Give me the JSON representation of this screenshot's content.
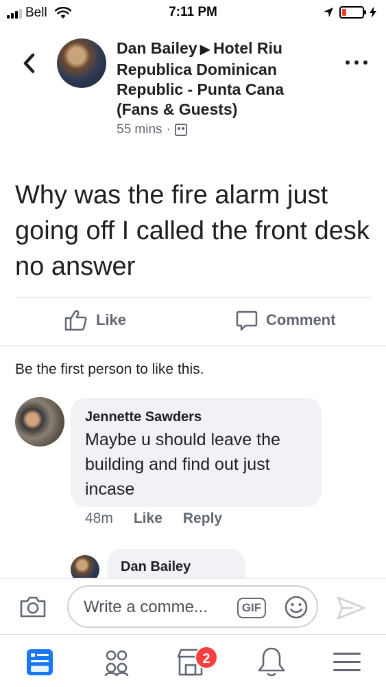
{
  "status_bar": {
    "carrier": "Bell",
    "time": "7:11 PM",
    "battery_color": "#ff3b30"
  },
  "post": {
    "author": "Dan Bailey",
    "group": "Hotel Riu Republica Dominican Republic - Punta Cana (Fans & Guests)",
    "time": "55 mins",
    "separator": "·",
    "body": "Why was the fire alarm just going off I called the front desk no answer",
    "like_label": "Like",
    "comment_label": "Comment",
    "reactions_summary": "Be the first person to like this."
  },
  "comments": [
    {
      "author": "Jennette Sawders",
      "text": "Maybe u should leave the building and find out just incase",
      "time": "48m",
      "like_label": "Like",
      "reply_label": "Reply"
    },
    {
      "author": "Dan Bailey"
    }
  ],
  "composer": {
    "placeholder": "Write a comme...",
    "gif_label": "GIF"
  },
  "tab_bar": {
    "icons": [
      "news-feed-icon",
      "groups-icon",
      "marketplace-icon",
      "notifications-icon",
      "menu-icon"
    ],
    "marketplace_badge": "2",
    "active_color": "#1877f2",
    "badge_color": "#fa3e3e"
  }
}
